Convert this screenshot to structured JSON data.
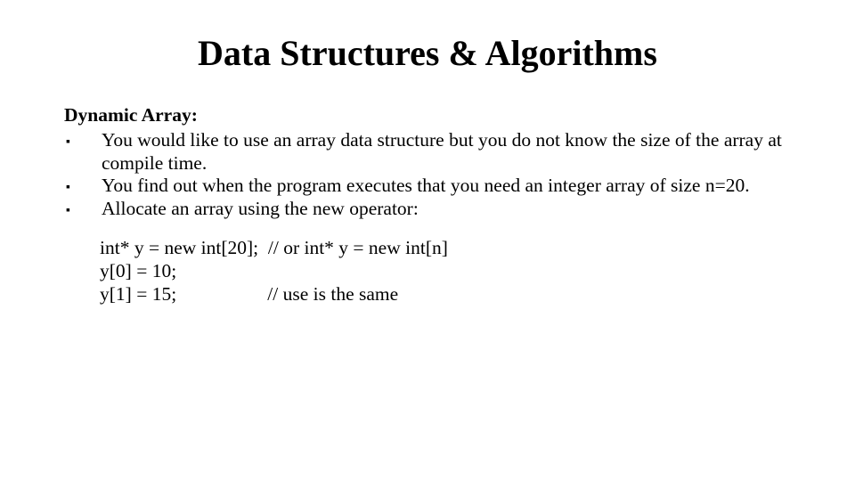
{
  "title": "Data Structures & Algorithms",
  "section": {
    "heading": "Dynamic Array:",
    "bullets": [
      "You would like to use an array data structure but you do not know the size of the array at compile time.",
      "You find out when the program executes that you need an integer array of size n=20.",
      "Allocate an array using the new operator:"
    ],
    "code": [
      "int* y = new int[20];  // or int* y = new int[n]",
      "y[0] = 10;",
      "y[1] = 15;                   // use is the same"
    ]
  }
}
